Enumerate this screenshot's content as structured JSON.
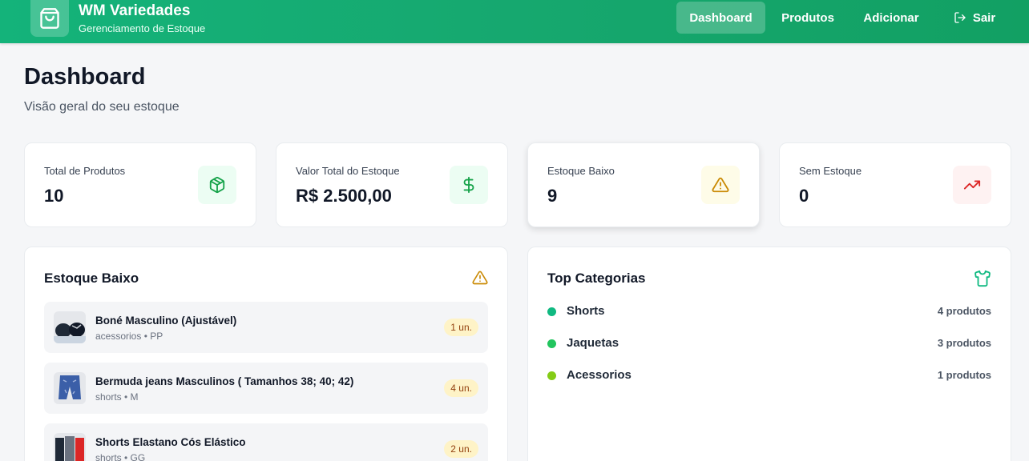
{
  "brand": {
    "title": "WM Variedades",
    "subtitle": "Gerenciamento de Estoque"
  },
  "nav": [
    {
      "label": "Dashboard",
      "active": true
    },
    {
      "label": "Produtos",
      "active": false
    },
    {
      "label": "Adicionar",
      "active": false
    },
    {
      "label": "Sair",
      "icon": "logout-icon",
      "active": false
    }
  ],
  "page": {
    "title": "Dashboard",
    "subtitle": "Visão geral do seu estoque"
  },
  "stats": [
    {
      "label": "Total de Produtos",
      "value": "10",
      "icon": "package-icon",
      "color": "#16a34a",
      "bg": "#ecfdf3"
    },
    {
      "label": "Valor Total do Estoque",
      "value": "R$ 2.500,00",
      "icon": "dollar-icon",
      "color": "#16a34a",
      "bg": "#ecfdf3"
    },
    {
      "label": "Estoque Baixo",
      "value": "9",
      "icon": "warning-icon",
      "color": "#ca8a04",
      "bg": "#fefce8"
    },
    {
      "label": "Sem Estoque",
      "value": "0",
      "icon": "trending-icon",
      "color": "#dc2626",
      "bg": "#fef2f2"
    }
  ],
  "low_stock": {
    "title": "Estoque Baixo",
    "items": [
      {
        "name": "Boné Masculino (Ajustável)",
        "meta": "acessorios • PP",
        "qty": "1 un."
      },
      {
        "name": "Bermuda jeans Masculinos ( Tamanhos 38; 40; 42)",
        "meta": "shorts • M",
        "qty": "4 un."
      },
      {
        "name": "Shorts Elastano Cós Elástico",
        "meta": "shorts • GG",
        "qty": "2 un."
      }
    ]
  },
  "top_categories": {
    "title": "Top Categorias",
    "items": [
      {
        "name": "Shorts",
        "count": "4 produtos",
        "color": "#10b981"
      },
      {
        "name": "Jaquetas",
        "count": "3 produtos",
        "color": "#22c55e"
      },
      {
        "name": "Acessorios",
        "count": "1 produtos",
        "color": "#84cc16"
      }
    ]
  }
}
